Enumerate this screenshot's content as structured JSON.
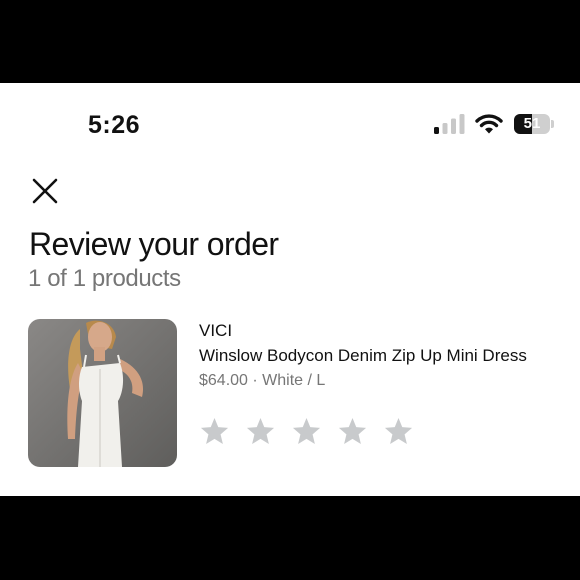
{
  "status_bar": {
    "time": "5:26",
    "battery_level": "51",
    "battery_fraction": 0.51,
    "signal_icon": "cellular-signal-icon",
    "wifi_icon": "wifi-icon"
  },
  "header": {
    "close_icon": "close-icon",
    "title": "Review your order",
    "subtitle": "1 of 1 products"
  },
  "product": {
    "brand": "VICI",
    "name": "Winslow Bodycon Denim Zip Up Mini Dress",
    "meta": "$64.00 · White / L",
    "rating": {
      "max": 5,
      "selected": 0,
      "star_icon": "star-icon",
      "empty_color": "#c8cacc"
    }
  },
  "colors": {
    "text_primary": "#111111",
    "text_secondary": "#767676",
    "background": "#ffffff"
  }
}
